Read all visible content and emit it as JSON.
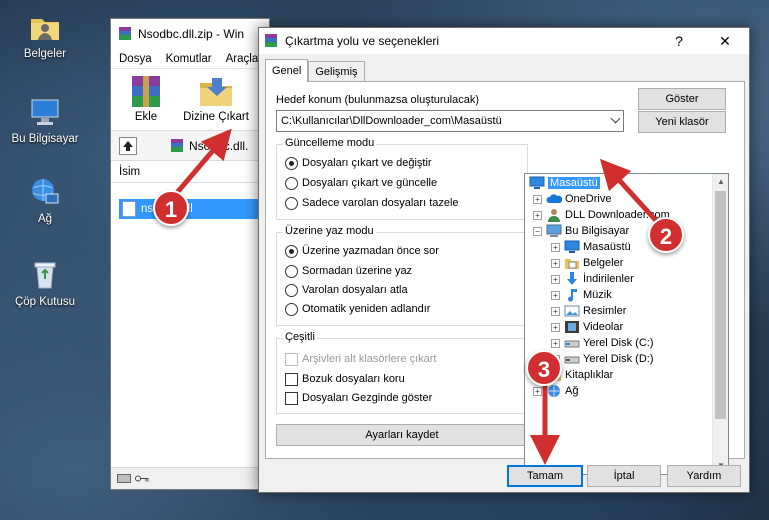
{
  "desktop": {
    "icons": [
      {
        "label": "Belgeler",
        "icon": "documents-folder-icon"
      },
      {
        "label": "Bu Bilgisayar",
        "icon": "computer-icon"
      },
      {
        "label": "Ağ",
        "icon": "network-icon"
      },
      {
        "label": "Çöp Kutusu",
        "icon": "recycle-bin-icon"
      }
    ]
  },
  "winrar": {
    "title": "Nsodbc.dll.zip - Win",
    "menu": [
      "Dosya",
      "Komutlar",
      "Araçla"
    ],
    "toolbar": {
      "add_label": "Ekle",
      "extract_label": "Dizine Çıkart"
    },
    "path_text": "Nsodbc.dll.",
    "column_name": "İsim",
    "file_name": "nsodbc.dll"
  },
  "dialog": {
    "title": "Çıkartma yolu ve seçenekleri",
    "help_glyph": "?",
    "close_glyph": "✕",
    "tabs": [
      "Genel",
      "Gelişmiş"
    ],
    "destination_label": "Hedef konum (bulunmazsa oluşturulacak)",
    "destination_value": "C:\\Kullanıcılar\\DllDownloader_com\\Masaüstü",
    "show_button": "Göster",
    "new_folder_button": "Yeni klasör",
    "update_mode": {
      "title": "Güncelleme modu",
      "options": [
        "Dosyaları çıkart ve değiştir",
        "Dosyaları çıkart ve güncelle",
        "Sadece varolan dosyaları tazele"
      ],
      "selected": 0
    },
    "overwrite_mode": {
      "title": "Üzerine yaz modu",
      "options": [
        "Üzerine yazmadan önce sor",
        "Sormadan üzerine yaz",
        "Varolan dosyaları atla",
        "Otomatik yeniden adlandır"
      ],
      "selected": 0
    },
    "misc": {
      "title": "Çeşitli",
      "options": [
        {
          "label": "Arşivleri alt klasörlere çıkart",
          "checked": false,
          "disabled": true
        },
        {
          "label": "Bozuk dosyaları koru",
          "checked": false,
          "disabled": false
        },
        {
          "label": "Dosyaları Gezginde göster",
          "checked": false,
          "disabled": false
        }
      ]
    },
    "save_settings_button": "Ayarları kaydet",
    "tree": [
      {
        "label": "Masaüstü",
        "level": 0,
        "expander": "",
        "icon": "desktop-icon",
        "selected": true
      },
      {
        "label": "OneDrive",
        "level": 1,
        "expander": "+",
        "icon": "onedrive-icon",
        "selected": false
      },
      {
        "label": "DLL Downloader.com",
        "level": 1,
        "expander": "+",
        "icon": "user-icon",
        "selected": false
      },
      {
        "label": "Bu Bilgisayar",
        "level": 1,
        "expander": "−",
        "icon": "computer-icon",
        "selected": false
      },
      {
        "label": "Masaüstü",
        "level": 2,
        "expander": "+",
        "icon": "desktop-icon",
        "selected": false
      },
      {
        "label": "Belgeler",
        "level": 2,
        "expander": "+",
        "icon": "documents-icon",
        "selected": false
      },
      {
        "label": "İndirilenler",
        "level": 2,
        "expander": "+",
        "icon": "downloads-icon",
        "selected": false
      },
      {
        "label": "Müzik",
        "level": 2,
        "expander": "+",
        "icon": "music-icon",
        "selected": false
      },
      {
        "label": "Resimler",
        "level": 2,
        "expander": "+",
        "icon": "pictures-icon",
        "selected": false
      },
      {
        "label": "Videolar",
        "level": 2,
        "expander": "+",
        "icon": "videos-icon",
        "selected": false
      },
      {
        "label": "Yerel Disk (C:)",
        "level": 2,
        "expander": "+",
        "icon": "drive-icon",
        "selected": false
      },
      {
        "label": "Yerel Disk (D:)",
        "level": 2,
        "expander": "+",
        "icon": "drive-icon",
        "selected": false
      },
      {
        "label": "Kitaplıklar",
        "level": 1,
        "expander": "+",
        "icon": "libraries-icon",
        "selected": false
      },
      {
        "label": "Ağ",
        "level": 1,
        "expander": "+",
        "icon": "network-icon",
        "selected": false
      }
    ],
    "ok_button": "Tamam",
    "cancel_button": "İptal",
    "help_button": "Yardım"
  },
  "annotations": [
    "1",
    "2",
    "3"
  ],
  "colors": {
    "annotation": "#d12f2f",
    "selection": "#3399ff",
    "accent": "#0078d7"
  }
}
